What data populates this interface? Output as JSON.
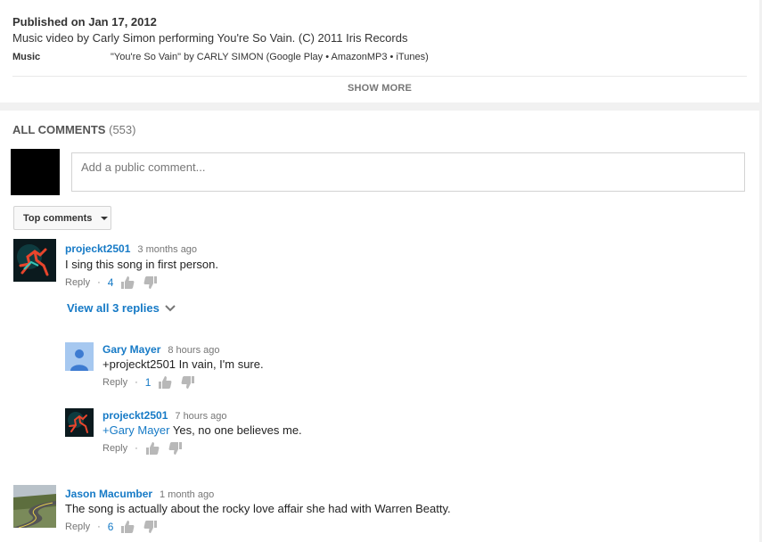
{
  "description": {
    "published": "Published on Jan 17, 2012",
    "text": "Music video by Carly Simon performing You're So Vain. (C) 2011 Iris Records",
    "music_label": "Music",
    "music_value": "\"You're So Vain\" by CARLY SIMON (Google Play • AmazonMP3 • iTunes)",
    "show_more": "SHOW MORE"
  },
  "comments_section": {
    "title": "ALL COMMENTS",
    "count": "(553)",
    "input_placeholder": "Add a public comment...",
    "sort_label": "Top comments"
  },
  "comments": [
    {
      "author": "projeckt2501",
      "time": "3 months ago",
      "text": "I sing this song in first person.",
      "reply": "Reply",
      "dot": "·",
      "likes": "4",
      "view_replies": "View all 3 replies"
    },
    {
      "author": "Jason Macumber",
      "time": "1 month ago",
      "text": "The song is actually about the rocky love affair she had with Warren Beatty.",
      "reply": "Reply",
      "dot": "·",
      "likes": "6"
    }
  ],
  "replies": [
    {
      "author": "Gary Mayer",
      "time": "8 hours ago",
      "text": "+projeckt2501 In vain, I'm sure.",
      "reply": "Reply",
      "dot": "·",
      "likes": "1"
    },
    {
      "author": "projeckt2501",
      "time": "7 hours ago",
      "mention": "+Gary Mayer",
      "text": " Yes, no one believes me.",
      "reply": "Reply",
      "dot": "·",
      "likes": ""
    }
  ],
  "colors": {
    "link": "#167ac6",
    "muted": "#767676",
    "page_bg": "#f1f1f1"
  }
}
